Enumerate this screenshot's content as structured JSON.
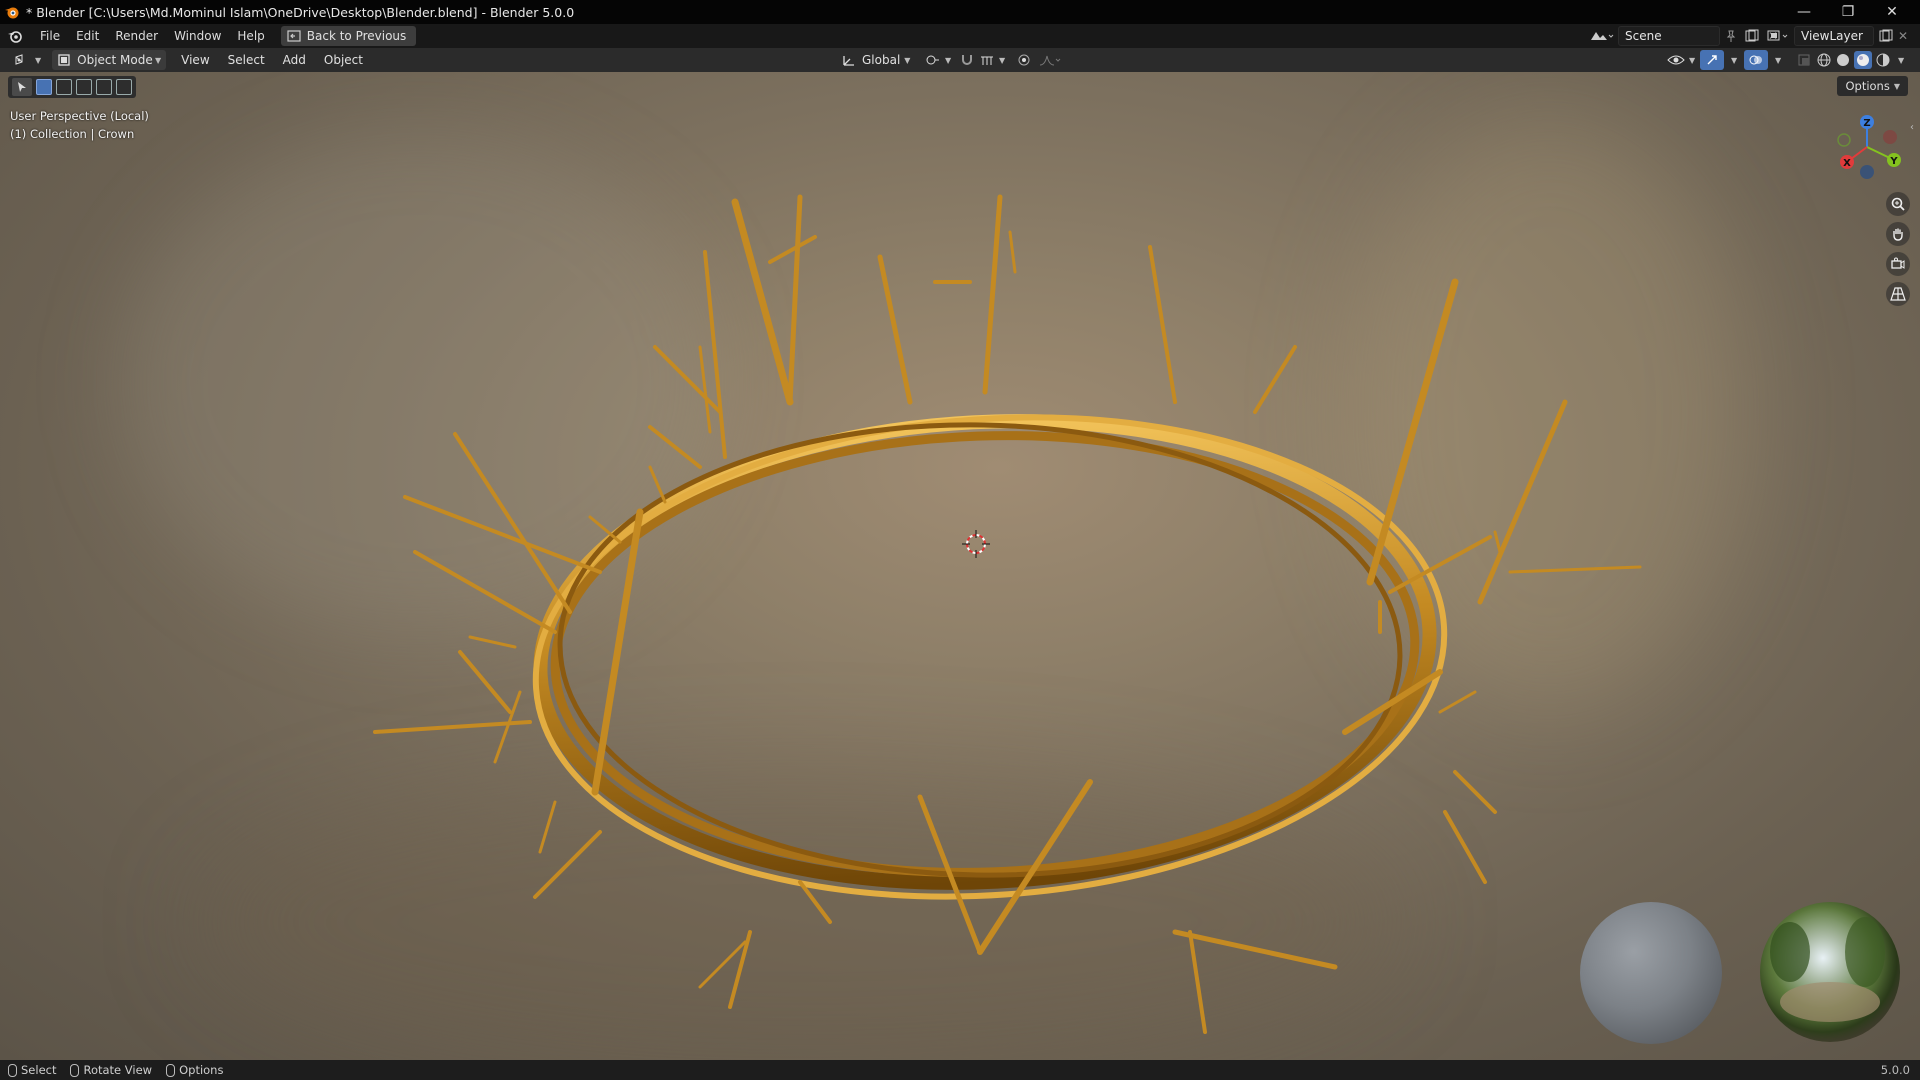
{
  "window": {
    "title": "* Blender [C:\\Users\\Md.Mominul Islam\\OneDrive\\Desktop\\Blender.blend] - Blender 5.0.0",
    "minimize": "—",
    "maximize": "❐",
    "close": "✕"
  },
  "menu": [
    "File",
    "Edit",
    "Render",
    "Window",
    "Help"
  ],
  "back_button": "Back to Previous",
  "scene": {
    "label": "Scene"
  },
  "view_layer": {
    "label": "ViewLayer"
  },
  "header": {
    "mode": "Object Mode",
    "menus": [
      "View",
      "Select",
      "Add",
      "Object"
    ],
    "transform_orientation": "Global"
  },
  "viewport": {
    "perspective": "User Perspective (Local)",
    "collection": "(1) Collection | Crown",
    "options": "Options"
  },
  "gizmo": {
    "z": "Z",
    "y": "Y",
    "x": "X"
  },
  "status": {
    "select": "Select",
    "rotate": "Rotate View",
    "options": "Options",
    "version": "5.0.0"
  },
  "colors": {
    "gold": "#c48a22",
    "accent": "#4772b3",
    "axis_x": "#e23b3b",
    "axis_y": "#84c21f",
    "axis_z": "#3d7fe0"
  }
}
